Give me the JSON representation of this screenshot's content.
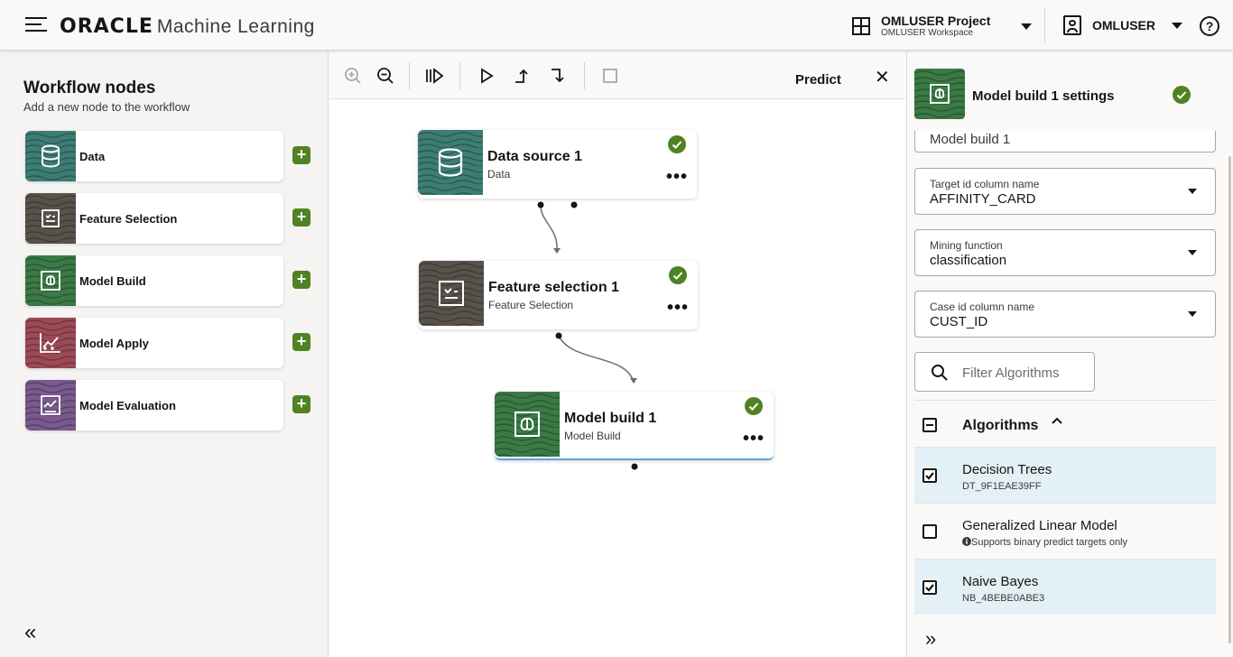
{
  "header": {
    "brand": "ORACLE",
    "product": "Machine Learning",
    "project_name": "OMLUSER Project",
    "workspace_name": "OMLUSER Workspace",
    "user_name": "OMLUSER",
    "help_label": "?"
  },
  "left_panel": {
    "title": "Workflow nodes",
    "subtitle": "Add a new node to the workflow",
    "items": [
      {
        "label": "Data",
        "icon": "database-icon",
        "color": "#3d7d75"
      },
      {
        "label": "Feature Selection",
        "icon": "checklist-icon",
        "color": "#58524b"
      },
      {
        "label": "Model Build",
        "icon": "brain-icon",
        "color": "#3a7a45"
      },
      {
        "label": "Model Apply",
        "icon": "chart-line-icon",
        "color": "#9c4a57"
      },
      {
        "label": "Model Evaluation",
        "icon": "evaluation-icon",
        "color": "#7a5a8e"
      }
    ],
    "add_label": "+",
    "collapse_label": "«"
  },
  "canvas": {
    "toolbar": {
      "predict_label": "Predict",
      "close_label": "✕"
    },
    "nodes": [
      {
        "name": "Data source 1",
        "type": "Data",
        "color": "#3d7d75"
      },
      {
        "name": "Feature selection 1",
        "type": "Feature Selection",
        "color": "#58524b"
      },
      {
        "name": "Model build 1",
        "type": "Model Build",
        "color": "#3a7a45"
      }
    ],
    "more_label": "•••"
  },
  "settings": {
    "title": "Model build 1 settings",
    "name_value": "Model build 1",
    "fields": [
      {
        "label": "Target id column name",
        "value": "AFFINITY_CARD"
      },
      {
        "label": "Mining function",
        "value": "classification"
      },
      {
        "label": "Case id column name",
        "value": "CUST_ID"
      }
    ],
    "filter_placeholder": "Filter Algorithms",
    "algorithms_label": "Algorithms",
    "algorithms": [
      {
        "name": "Decision Trees",
        "detail": "DT_9F1EAE39FF",
        "checked": true
      },
      {
        "name": "Generalized Linear Model",
        "detail": "Supports binary predict targets only",
        "checked": false
      },
      {
        "name": "Naive Bayes",
        "detail": "NB_4BEBE0ABE3",
        "checked": true
      }
    ],
    "collapse_label": "»"
  },
  "colors": {
    "success": "#508223",
    "accent": "#5ba5d8"
  }
}
